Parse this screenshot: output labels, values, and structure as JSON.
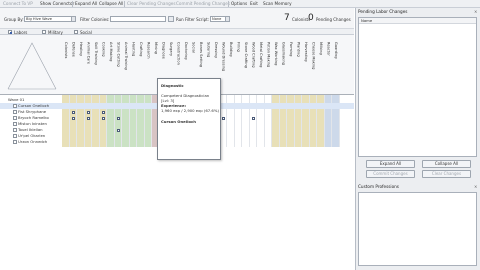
{
  "menu": [
    {
      "label": "Connect To VP",
      "enabled": false
    },
    {
      "label": "Show Conenctor",
      "enabled": true
    },
    {
      "label": "Expand All",
      "enabled": true
    },
    {
      "label": "Collapse All",
      "enabled": true
    },
    {
      "label": "Clear Pending Changes",
      "enabled": false
    },
    {
      "label": "Commit Pending Changes",
      "enabled": false
    },
    {
      "label": "Options",
      "enabled": true
    },
    {
      "label": "Exit",
      "enabled": true
    },
    {
      "label": "Scan Memory",
      "enabled": true
    }
  ],
  "toolbar": {
    "group_by_label": "Group By:",
    "group_by_value": "Big Hive Wave",
    "filter_label": "Filter Colonies:",
    "filter_value": "",
    "script_label": "Run Filter Script:",
    "script_value": "None",
    "colonists_count": "7",
    "colonists_label": "Colonists",
    "pending_count": "0",
    "pending_label": "Pending Changes"
  },
  "subbar": {
    "labor_label": "Labors",
    "military_label": "Military",
    "social_label": "Social"
  },
  "columns": [
    "Colonists",
    "Defense",
    "Healing",
    "Animal Care",
    "Skill Training",
    "Cooking",
    "Art Making",
    "Stone Cutting",
    "Animal Training",
    "Hunting",
    "Crafting",
    "Research",
    "Mining",
    "Diagnose",
    "Surgery",
    "Construction",
    "Doctoring",
    "Social",
    "Bones Setting",
    "Suturing",
    "Dressing",
    "Wound Dressing",
    "Building",
    "Firing",
    "Stone Crafting",
    "Wood Crafting",
    "Metal Crafting",
    "Potion Making",
    "Wax Working",
    "Glassmaking",
    "Farming",
    "Planting",
    "Harvesting",
    "Cheese Making",
    "Milking",
    "Reactor",
    "Guarding"
  ],
  "tree": {
    "root": "Wave 01",
    "colonists": [
      "Curson Onelloch",
      "Fist Shryphane",
      "Bryoch Ramelko",
      "Mistun Ivinsten",
      "Touel Iklellan",
      "Ur'pel Okarlen",
      "Urzon Onnedch"
    ]
  },
  "tooltip": {
    "title": "Diagnostic",
    "line1": "Competent Diagnostician",
    "line2": "[Lvl: 3]",
    "line3_label": "Experience:",
    "line3_value": "1,960 exp / 2,900 exp (67.6%)",
    "colonist": "Curson Onelloch"
  },
  "right_panel": {
    "pending_title": "Pending Labor Changes",
    "list_header": "Name",
    "expand_all": "Expand All",
    "collapse_all": "Collapse All",
    "commit": "Commit Changes",
    "clear": "Clear Changes",
    "profession_title": "Custom Professions"
  },
  "colors": {
    "highlight_green": "#6fcf52",
    "highlight_purple": "#6a5aa8",
    "selected_row": "#dbe6f6",
    "tint_red": "#d8c4c4",
    "tint_yellow": "#e8e0b8",
    "tint_green": "#cbe2c4",
    "tint_blue": "#cdd9ea"
  }
}
